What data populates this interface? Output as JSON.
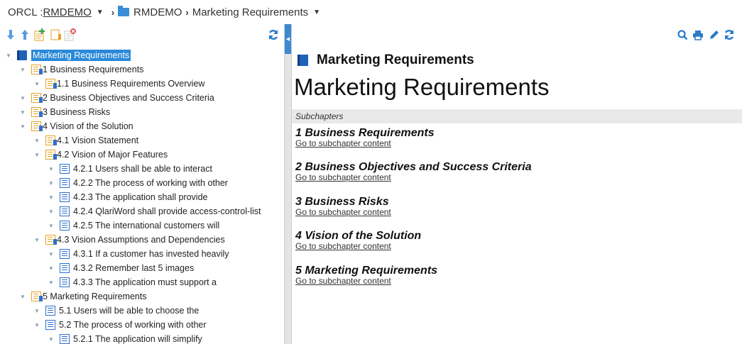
{
  "breadcrumb": {
    "prefix": "ORCL : ",
    "repo": "RMDEMO",
    "folder": "RMDEMO",
    "document": "Marketing Requirements",
    "arrow_down": "▼",
    "separator": "›"
  },
  "tree": {
    "items": [
      {
        "label": "Marketing Requirements",
        "icon": "book-icon"
      },
      {
        "label": "1 Business Requirements",
        "icon": "chapter-icon"
      },
      {
        "label": "1.1 Business Requirements Overview",
        "icon": "chapter-icon"
      },
      {
        "label": "2 Business Objectives and Success Criteria",
        "icon": "chapter-icon"
      },
      {
        "label": "3 Business Risks",
        "icon": "chapter-icon"
      },
      {
        "label": "4 Vision of the Solution",
        "icon": "chapter-icon"
      },
      {
        "label": "4.1 Vision Statement",
        "icon": "chapter-icon"
      },
      {
        "label": "4.2 Vision of Major Features",
        "icon": "chapter-icon"
      },
      {
        "label": "4.2.1 Users shall be able to interact",
        "icon": "requirement-icon"
      },
      {
        "label": "4.2.2 The process of working with other",
        "icon": "requirement-icon"
      },
      {
        "label": "4.2.3 The application shall provide",
        "icon": "requirement-icon"
      },
      {
        "label": "4.2.4 QlariWord shall provide access-control-list",
        "icon": "requirement-icon"
      },
      {
        "label": "4.2.5 The international customers will",
        "icon": "requirement-icon"
      },
      {
        "label": "4.3 Vision Assumptions and Dependencies",
        "icon": "chapter-icon"
      },
      {
        "label": "4.3.1 If a customer has invested heavily",
        "icon": "requirement-icon"
      },
      {
        "label": "4.3.2 Remember last 5 images",
        "icon": "requirement-icon"
      },
      {
        "label": "4.3.3 The application must support a",
        "icon": "requirement-icon"
      },
      {
        "label": "5 Marketing Requirements",
        "icon": "chapter-icon"
      },
      {
        "label": "5.1 Users will be able to choose the",
        "icon": "requirement-icon"
      },
      {
        "label": "5.2 The process of working with other",
        "icon": "requirement-icon"
      },
      {
        "label": "5.2.1 The application will simplify",
        "icon": "requirement-icon"
      }
    ]
  },
  "content": {
    "header": "Marketing Requirements",
    "title": "Marketing Requirements",
    "subchapters_label": "Subchapters",
    "link_text": "Go to subchapter content",
    "subchapters": [
      "1 Business Requirements",
      "2 Business Objectives and Success Criteria",
      "3 Business Risks",
      "4 Vision of the Solution",
      "5 Marketing Requirements"
    ]
  },
  "colors": {
    "accent": "#2a7cc7",
    "selection": "#2a8ad8",
    "chapter_icon": "#e8a023"
  }
}
